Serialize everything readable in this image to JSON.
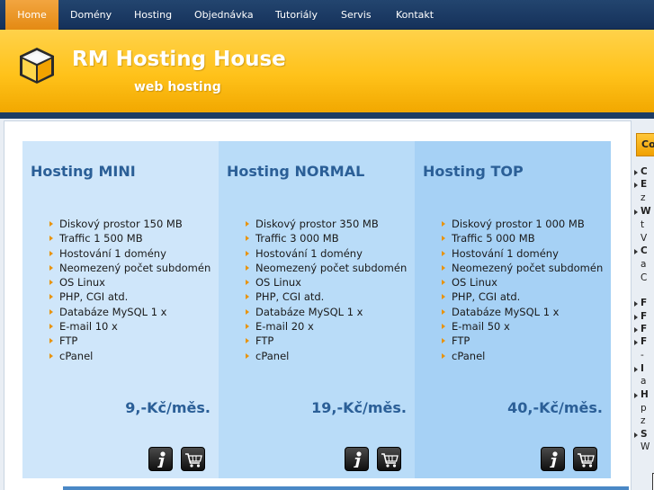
{
  "nav": {
    "items": [
      "Home",
      "Domény",
      "Hosting",
      "Objednávka",
      "Tutoriály",
      "Servis",
      "Kontakt"
    ],
    "active": "Home"
  },
  "header": {
    "title": "RM Hosting House",
    "subtitle": "web hosting"
  },
  "plans": [
    {
      "name": "Hosting MINI",
      "features": [
        "Diskový prostor 150 MB",
        "Traffic 1 500 MB",
        "Hostování 1 domény",
        "Neomezený počet subdomén",
        "OS Linux",
        "PHP, CGI atd.",
        "Databáze MySQL 1 x",
        "E-mail 10 x",
        "FTP",
        "cPanel"
      ],
      "price": "9,-Kč/měs."
    },
    {
      "name": "Hosting NORMAL",
      "features": [
        "Diskový prostor 350 MB",
        "Traffic 3 000 MB",
        "Hostování 1 domény",
        "Neomezený počet subdomén",
        "OS Linux",
        "PHP, CGI atd.",
        "Databáze MySQL 1 x",
        "E-mail 20 x",
        "FTP",
        "cPanel"
      ],
      "price": "19,-Kč/měs."
    },
    {
      "name": "Hosting TOP",
      "features": [
        "Diskový prostor 1 000 MB",
        "Traffic 5 000 MB",
        "Hostování 1 domény",
        "Neomezený počet subdomén",
        "OS Linux",
        "PHP, CGI atd.",
        "Databáze MySQL 1 x",
        "E-mail 50 x",
        "FTP",
        "cPanel"
      ],
      "price": "40,-Kč/měs."
    }
  ],
  "icons": {
    "info": "info-icon",
    "cart": "cart-icon",
    "logo": "cube-logo-icon"
  },
  "sidebar": {
    "heading": "Co",
    "lines": [
      "C",
      "E",
      "z",
      "W",
      "t",
      "V",
      "C",
      "a",
      "C",
      "F",
      "F",
      "F",
      "F",
      "-",
      "I",
      "a",
      "H",
      "p",
      "z",
      "S",
      "W"
    ]
  },
  "colors": {
    "nav_bg": "#1b3b64",
    "nav_active": "#ec9a2a",
    "header_yellow": "#ffc21a",
    "plan_mini": "#cfe6fa",
    "plan_normal": "#b9dcf8",
    "plan_top": "#a6d1f5",
    "heading_blue": "#2b5f97",
    "bullet_orange": "#e8930c"
  }
}
